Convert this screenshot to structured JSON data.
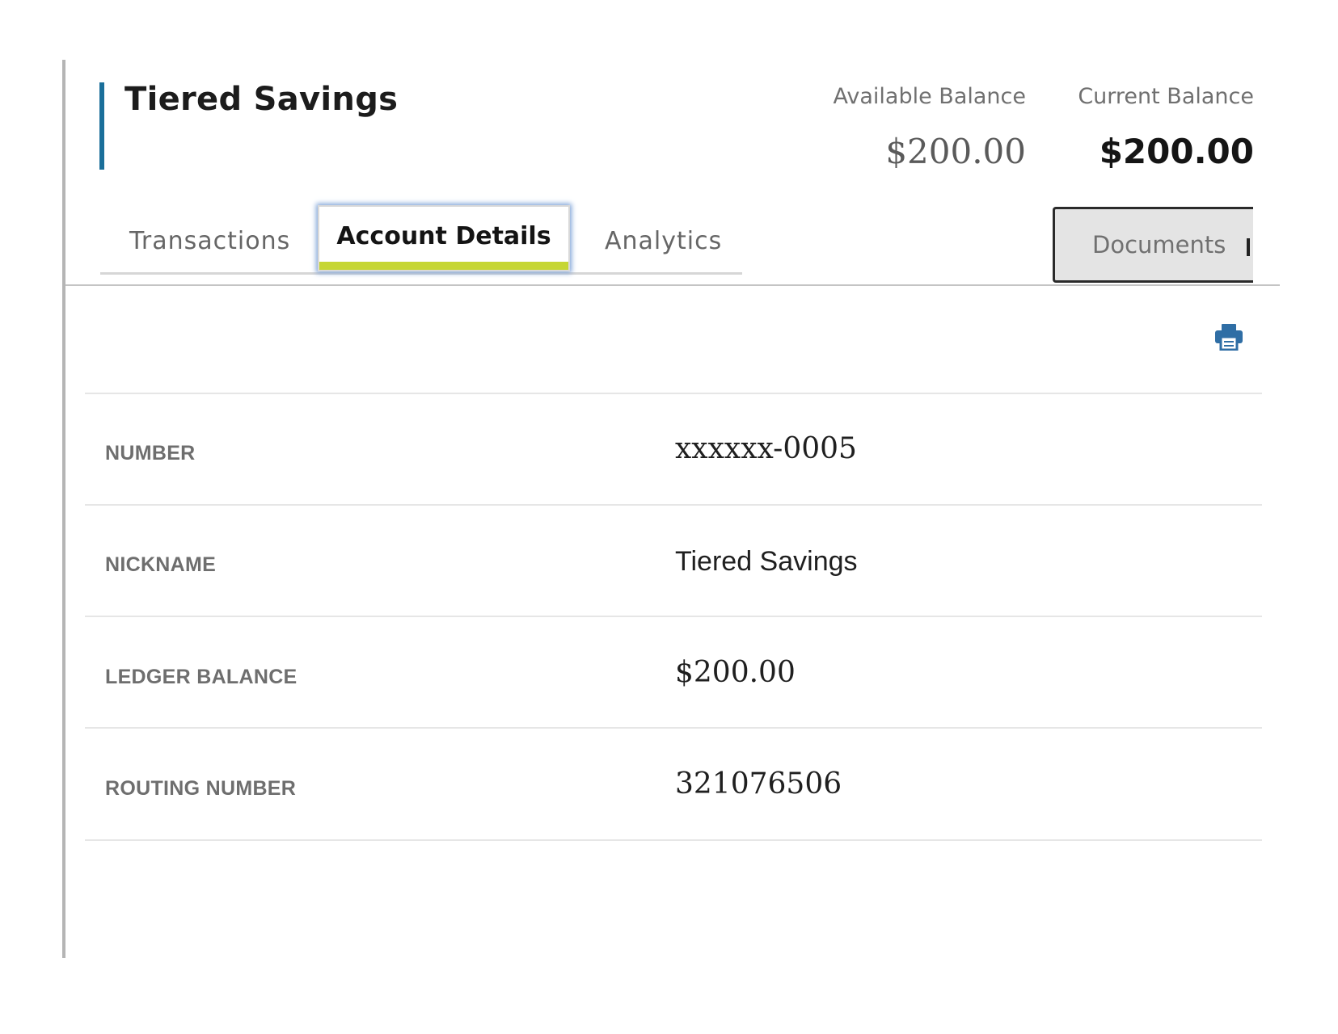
{
  "account": {
    "title": "Tiered Savings"
  },
  "balances": {
    "available": {
      "label": "Available Balance",
      "value": "$200.00"
    },
    "current": {
      "label": "Current Balance",
      "value": "$200.00"
    }
  },
  "tabs": [
    {
      "label": "Transactions",
      "active": false
    },
    {
      "label": "Account Details",
      "active": true
    },
    {
      "label": "Analytics",
      "active": false
    }
  ],
  "documents_button": {
    "label": "Documents"
  },
  "icons": {
    "print": "print-icon"
  },
  "colors": {
    "title_accent": "#1a6f9a",
    "active_tab_bar": "#c6d634",
    "print_icon": "#2f6ea5"
  },
  "details": [
    {
      "label": "NUMBER",
      "value": "xxxxxx-0005"
    },
    {
      "label": "NICKNAME",
      "value": "Tiered Savings"
    },
    {
      "label": "LEDGER BALANCE",
      "value": "$200.00"
    },
    {
      "label": "ROUTING NUMBER",
      "value": "321076506"
    }
  ]
}
